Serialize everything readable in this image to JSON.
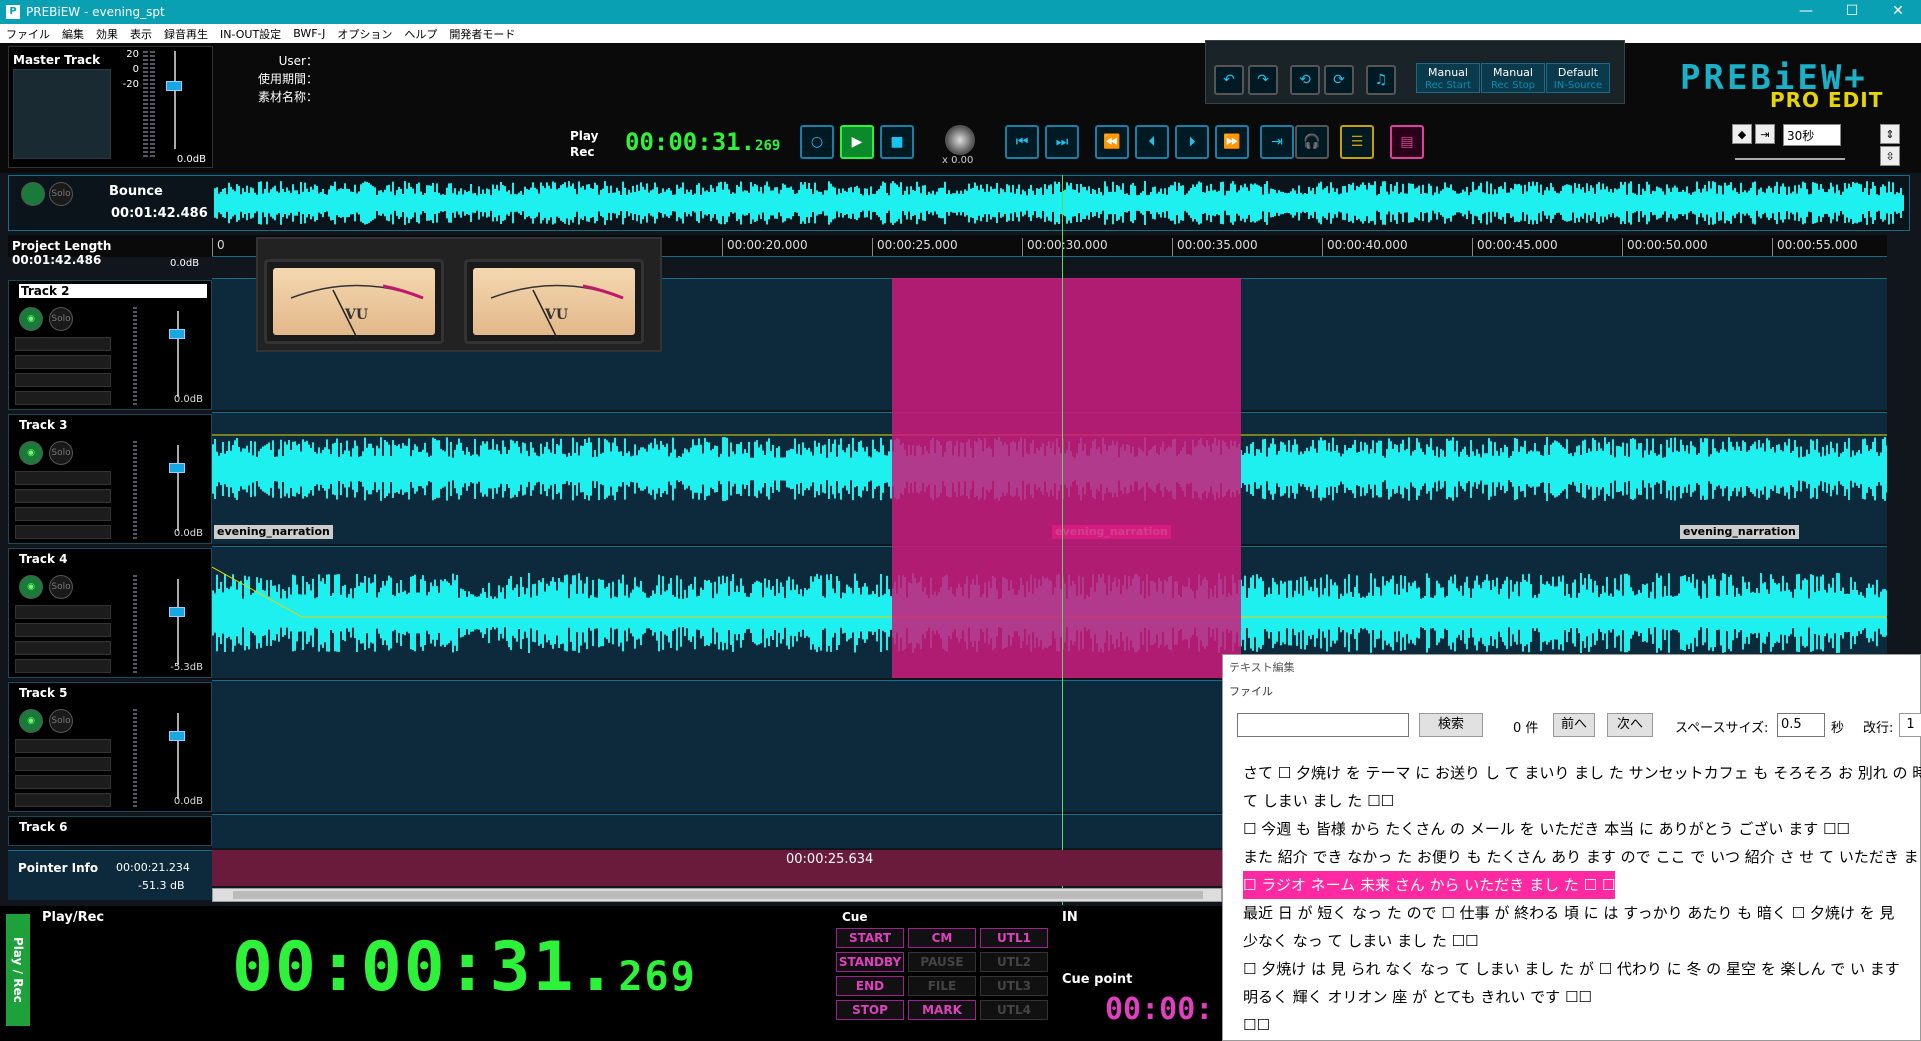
{
  "window": {
    "title": "PREBiEW - evening_spt",
    "logo_letter": "P",
    "minimize": "—",
    "maximize": "☐",
    "close": "✕"
  },
  "menu": [
    "ファイル",
    "編集",
    "効果",
    "表示",
    "録音再生",
    "IN-OUT設定",
    "BWF-J",
    "オプション",
    "ヘルプ",
    "開発者モード"
  ],
  "master": {
    "label": "Master Track",
    "scale": [
      "20",
      "0",
      "-20"
    ],
    "db": "0.0dB"
  },
  "user_info": {
    "user": "User：",
    "period": "使用期間：",
    "material": "素材名称："
  },
  "transport": {
    "play": "Play",
    "rec": "Rec",
    "timecode": "00:00:31.",
    "timecode_ms": "269",
    "speed": "x 0.00"
  },
  "edit_panel": {
    "buttons": [
      {
        "top": "Manual",
        "sub": "Rec Start"
      },
      {
        "top": "Manual",
        "sub": "Rec Stop"
      },
      {
        "top": "Default",
        "sub": "IN-Source"
      }
    ]
  },
  "logo": {
    "main": "PREBiEW+",
    "sub": "PRO EDIT"
  },
  "zoom": {
    "value": "30秒"
  },
  "bounce": {
    "name": "Bounce",
    "time": "00:01:42.486"
  },
  "project": {
    "label": "Project Length",
    "value": "00:01:42.486",
    "db_top": "0.0dB"
  },
  "ruler": [
    "0",
    "00:00:20.000",
    "00:00:25.000",
    "00:00:30.000",
    "00:00:35.000",
    "00:00:40.000",
    "00:00:45.000",
    "00:00:50.000",
    "00:00:55.000"
  ],
  "tracks": [
    {
      "name": "Track 2",
      "db": "0.0dB",
      "mute": "◉",
      "solo": "Solo"
    },
    {
      "name": "Track 3",
      "db": "0.0dB",
      "mute": "◉",
      "solo": "Solo"
    },
    {
      "name": "Track 4",
      "db": "-5.3dB",
      "mute": "◉",
      "solo": "Solo"
    },
    {
      "name": "Track 5",
      "db": "0.0dB",
      "mute": "◉",
      "solo": "Solo"
    },
    {
      "name": "Track 6"
    }
  ],
  "clips": {
    "c1": "evening_narration",
    "c2": "evening_narration",
    "c3": "evening_narration"
  },
  "vu": {
    "left": "VU",
    "right": "VU"
  },
  "pointer": {
    "label": "Pointer Info",
    "time": "00:00:21.234",
    "db": "-51.3 dB"
  },
  "lower_time": "00:00:25.634",
  "bottom": {
    "vertical_tab": "Play / Rec",
    "label": "Play/Rec",
    "timecode": "00:00:31.",
    "timecode_ms": "269",
    "cue_label": "Cue",
    "cue_buttons": [
      {
        "label": "START",
        "active": true
      },
      {
        "label": "CM",
        "active": true
      },
      {
        "label": "UTL1",
        "active": true
      },
      {
        "label": "STANDBY",
        "active": true
      },
      {
        "label": "PAUSE",
        "active": false
      },
      {
        "label": "UTL2",
        "active": false
      },
      {
        "label": "END",
        "active": true
      },
      {
        "label": "FILE",
        "active": false
      },
      {
        "label": "UTL3",
        "active": false
      },
      {
        "label": "STOP",
        "active": true
      },
      {
        "label": "MARK",
        "active": true
      },
      {
        "label": "UTL4",
        "active": false
      }
    ],
    "in_label": "IN",
    "cue_point_label": "Cue point",
    "cue_point_time": "00:00:"
  },
  "text_editor": {
    "title": "テキスト編集",
    "menu": "ファイル",
    "search_btn": "検索",
    "count": "0 件",
    "prev": "前へ",
    "next": "次へ",
    "space_label": "スペースサイズ:",
    "space_value": "0.5",
    "sec": "秒",
    "line_break": "改行:",
    "line_break_value": "1",
    "lines": [
      "さて ☐ 夕焼け を テーマ に お送り し て まいり まし た サンセットカフェ も そろそろ お 別れ の 時",
      "て しまい まし た ☐☐",
      "☐ 今週 も 皆様 から たくさん の メール を いただき 本当 に ありがとう ござい ます ☐☐",
      "また 紹介 でき なかっ た お便り も たくさん あり ます ので ここ で いつ 紹介 さ せ て いただき ま",
      "☐ ラジオ ネーム 未来 さん から いただき まし た ☐ ☐",
      "最近 日 が 短く なっ た ので ☐ 仕事 が 終わる 頃 に は すっかり あたり も 暗く ☐ 夕焼け を 見",
      "少なく なっ て しまい まし た ☐☐",
      "☐ 夕焼け は 見 られ なく なっ て しまい まし た が ☐ 代わり に 冬 の 星空 を 楽しん で い ます",
      "明るく 輝く オリオン 座 が とても きれい です ☐☐",
      "☐☐"
    ]
  }
}
